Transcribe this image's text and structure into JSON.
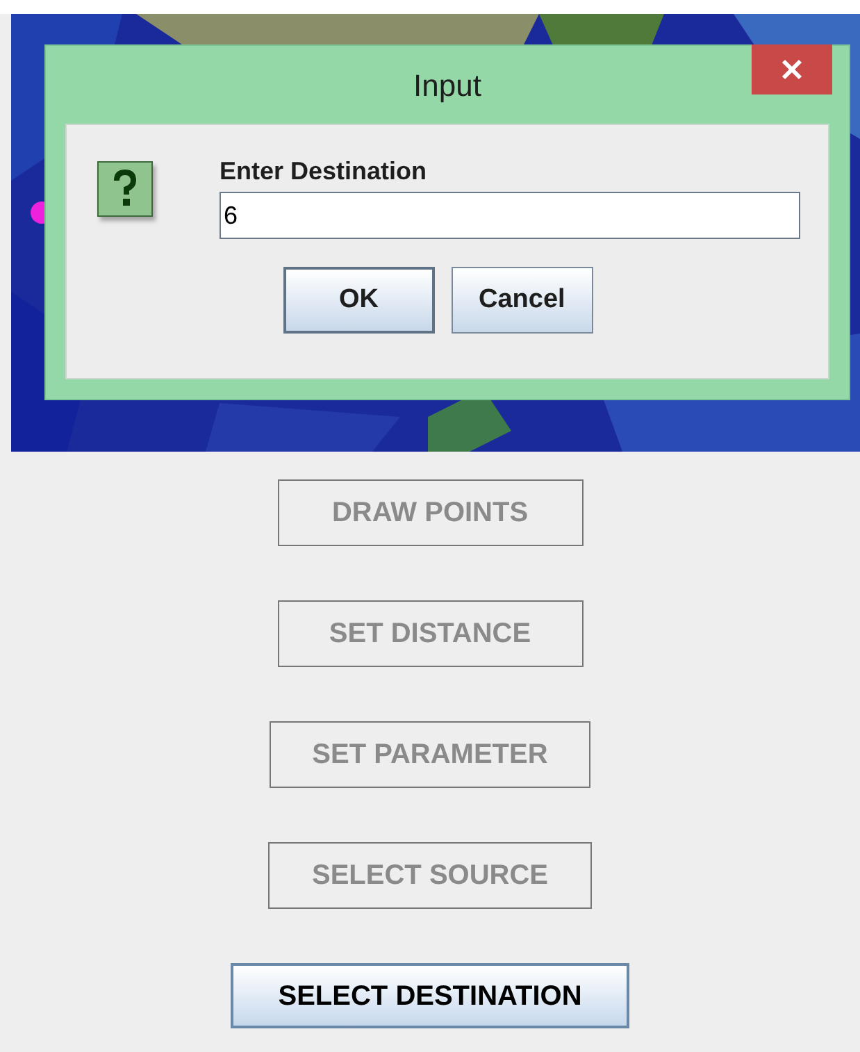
{
  "dialog": {
    "title": "Input",
    "prompt": "Enter Destination",
    "value": "6",
    "buttons": [
      {
        "label": "OK",
        "default": true
      },
      {
        "label": "Cancel",
        "default": false
      }
    ]
  },
  "actions": [
    {
      "label": "DRAW POINTS",
      "disabled": true
    },
    {
      "label": "SET DISTANCE",
      "disabled": true
    },
    {
      "label": "SET PARAMETER",
      "disabled": true
    },
    {
      "label": "SELECT SOURCE",
      "disabled": true
    },
    {
      "label": "SELECT DESTINATION",
      "disabled": false
    }
  ]
}
